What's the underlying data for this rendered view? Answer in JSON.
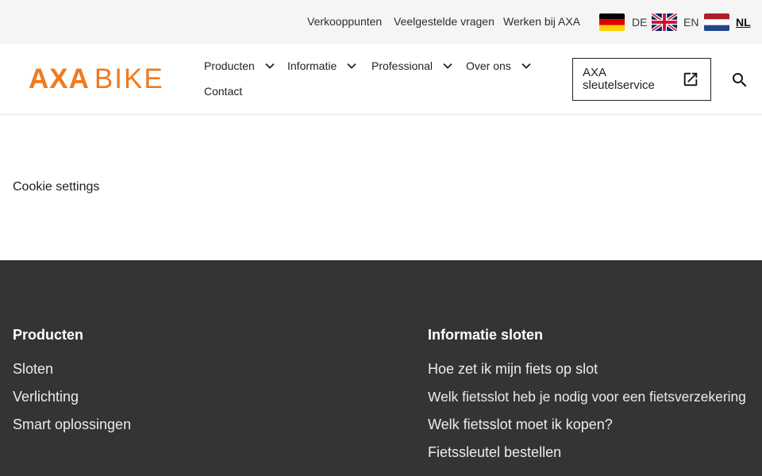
{
  "topbar": {
    "links": [
      "Verkooppunten",
      "Veelgestelde vragen",
      "Werken bij AXA"
    ],
    "languages": [
      {
        "code": "DE",
        "flag": "germany-flag-icon",
        "active": false
      },
      {
        "code": "EN",
        "flag": "uk-flag-icon",
        "active": false
      },
      {
        "code": "NL",
        "flag": "netherlands-flag-icon",
        "active": true
      }
    ]
  },
  "header": {
    "logo_primary": "AXA",
    "logo_secondary": "BIKE",
    "nav": [
      {
        "label": "Producten",
        "has_dropdown": true
      },
      {
        "label": "Informatie",
        "has_dropdown": true
      },
      {
        "label": "Professional",
        "has_dropdown": true
      },
      {
        "label": "Over ons",
        "has_dropdown": true
      },
      {
        "label": "Contact",
        "has_dropdown": false
      }
    ],
    "key_service_label": "AXA sleutelservice",
    "key_service_icon": "external-link-icon",
    "search_icon": "search-icon"
  },
  "main": {
    "cookie_settings": "Cookie settings"
  },
  "footer": {
    "columns": [
      {
        "title": "Producten",
        "links": [
          "Sloten",
          "Verlichting",
          "Smart oplossingen"
        ]
      },
      {
        "title": "Informatie sloten",
        "links": [
          "Hoe zet ik mijn fiets op slot",
          "Welk fietsslot heb je nodig voor een fietsverzekering",
          "Welk fietsslot moet ik kopen?",
          "Fietssleutel bestellen"
        ]
      }
    ]
  },
  "colors": {
    "brand_orange": "#f07a1f",
    "footer_bg": "#333435",
    "topbar_bg": "#f5f5f5"
  }
}
